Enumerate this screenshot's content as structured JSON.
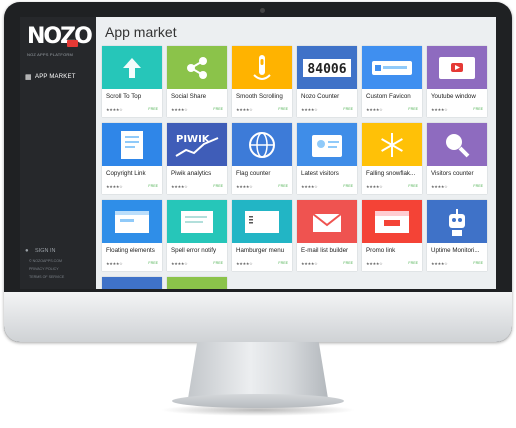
{
  "sidebar": {
    "logo_text": "NOZO",
    "logo_badge": "",
    "tagline": "NOZ APPS PLATFORM",
    "nav": [
      {
        "label": "APP MARKET",
        "icon": "store-icon"
      }
    ],
    "sign_in": {
      "label": "SIGN IN",
      "icon": "user-icon"
    },
    "footer_links": [
      "© NOZOAPPS.COM",
      "PRIVACY POLICY",
      "TERMS OF SERVICE"
    ]
  },
  "main": {
    "title": "App market",
    "price_label": "FREE",
    "stars_text": "★★★★☆"
  },
  "apps": [
    {
      "name": "Scroll To Top",
      "color": "#26c6b9",
      "icon": "arrow-up-icon"
    },
    {
      "name": "Social Share",
      "color": "#8bc34a",
      "icon": "share-icon"
    },
    {
      "name": "Smooth Scrolling",
      "color": "#ffb300",
      "icon": "scroll-hand-icon"
    },
    {
      "name": "Nozo Counter",
      "color": "#3f72c8",
      "icon": "counter-icon"
    },
    {
      "name": "Custom Favicon",
      "color": "#3f8ff0",
      "icon": "favicon-icon"
    },
    {
      "name": "Youtube window",
      "color": "#8e6bbf",
      "icon": "youtube-icon"
    },
    {
      "name": "Copyright Link",
      "color": "#2f86e8",
      "icon": "document-icon"
    },
    {
      "name": "Piwik analytics",
      "color": "#3f5db8",
      "icon": "piwik-chart-icon"
    },
    {
      "name": "Flag counter",
      "color": "#3d7bd8",
      "icon": "globe-icon"
    },
    {
      "name": "Latest visitors",
      "color": "#3f8de8",
      "icon": "id-card-icon"
    },
    {
      "name": "Falling snowflak...",
      "color": "#ffc107",
      "icon": "snowflake-icon"
    },
    {
      "name": "Visitors counter",
      "color": "#8e6bbf",
      "icon": "magnifier-icon"
    },
    {
      "name": "Floating elements",
      "color": "#2f8ee8",
      "icon": "window-icon"
    },
    {
      "name": "Spell error notify",
      "color": "#26c6b9",
      "icon": "page-icon"
    },
    {
      "name": "Hamburger menu",
      "color": "#22b5c5",
      "icon": "browser-icon"
    },
    {
      "name": "E-mail list builder",
      "color": "#ef5350",
      "icon": "mail-icon"
    },
    {
      "name": "Promo link",
      "color": "#f44336",
      "icon": "promo-window-icon"
    },
    {
      "name": "Uptime Monitori...",
      "color": "#3f72c8",
      "icon": "robot-icon"
    },
    {
      "name": "",
      "color": "#3f72c8",
      "icon": "blank-icon"
    },
    {
      "name": "",
      "color": "#8bc34a",
      "icon": "blank-icon"
    }
  ]
}
